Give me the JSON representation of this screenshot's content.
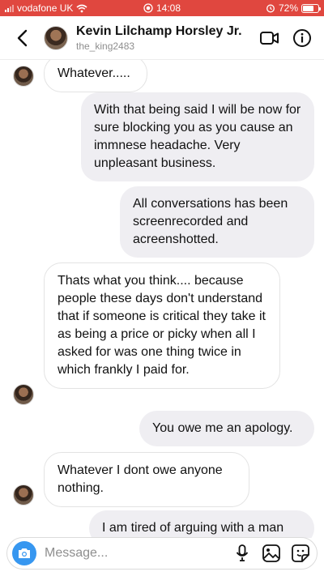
{
  "status_bar": {
    "carrier": "vodafone UK",
    "time": "14:08",
    "battery": "72%",
    "battery_level": 0.72
  },
  "header": {
    "name": "Kevin Lilchamp Horsley Jr.",
    "username": "the_king2483",
    "icons": [
      "back-icon",
      "video-call-icon",
      "info-icon"
    ]
  },
  "messages": [
    {
      "direction": "in",
      "text": "Whatever....."
    },
    {
      "direction": "out",
      "text": "With that being said I will be now for sure blocking you as you cause an immnese headache. Very unpleasant business."
    },
    {
      "direction": "out",
      "text": "All conversations has been screenrecorded and acreenshotted."
    },
    {
      "direction": "in",
      "text": "Thats what you think.... because people these days don't understand that if someone is critical they take it as being a price or picky when all I asked for was one thing twice in which frankly I paid for."
    },
    {
      "direction": "out",
      "text": "You owe me an apology."
    },
    {
      "direction": "in",
      "text": "Whatever I dont owe anyone nothing."
    },
    {
      "direction": "out",
      "text": "I am tired of arguing with a man"
    }
  ],
  "composer": {
    "placeholder": "Message...",
    "icons": [
      "camera-icon",
      "microphone-icon",
      "gallery-icon",
      "sticker-icon"
    ]
  }
}
